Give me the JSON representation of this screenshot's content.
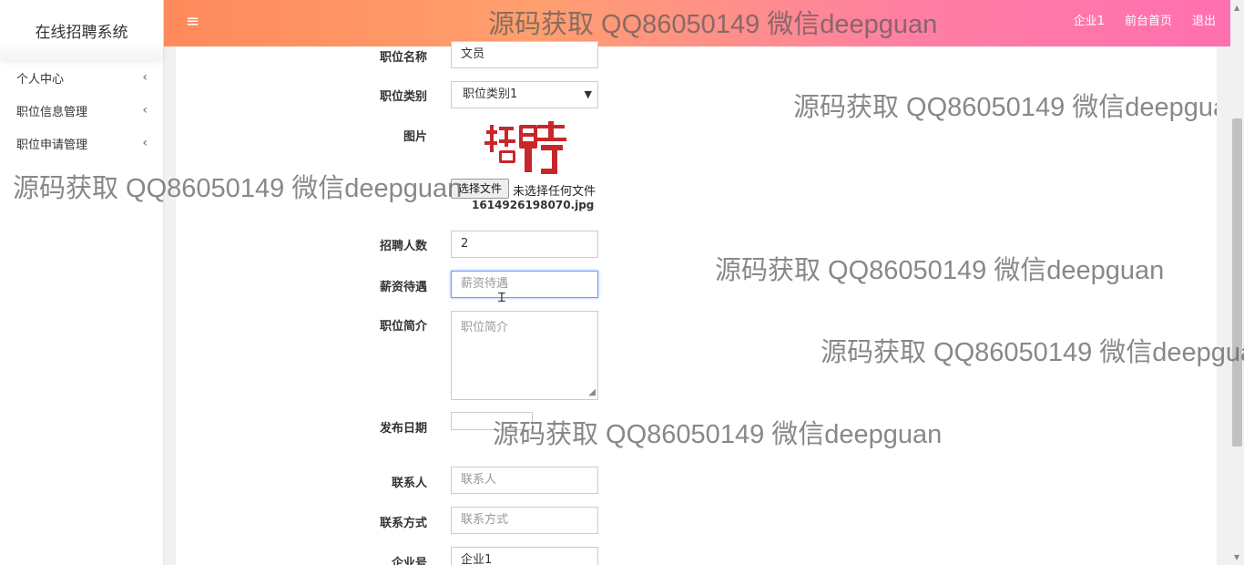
{
  "app": {
    "title": "在线招聘系统"
  },
  "sidebar": {
    "items": [
      {
        "label": "个人中心"
      },
      {
        "label": "职位信息管理"
      },
      {
        "label": "职位申请管理"
      }
    ],
    "chevron": "‹"
  },
  "header": {
    "menu_icon": "≡",
    "links": [
      {
        "label": "企业1"
      },
      {
        "label": "前台首页"
      },
      {
        "label": "退出"
      }
    ]
  },
  "form": {
    "job_name": {
      "label": "职位名称",
      "value": "文员"
    },
    "job_category": {
      "label": "职位类别",
      "value": "职位类别1"
    },
    "image": {
      "label": "图片",
      "file_button": "选择文件",
      "file_status": "未选择任何文件",
      "file_name": "1614926198070.jpg"
    },
    "headcount": {
      "label": "招聘人数",
      "value": "2"
    },
    "salary": {
      "label": "薪资待遇",
      "placeholder": "薪资待遇"
    },
    "intro": {
      "label": "职位简介",
      "placeholder": "职位简介"
    },
    "publish_date": {
      "label": "发布日期",
      "value": ""
    },
    "contact": {
      "label": "联系人",
      "placeholder": "联系人"
    },
    "contact_info": {
      "label": "联系方式",
      "placeholder": "联系方式"
    },
    "company_id": {
      "label": "企业号",
      "value": "企业1"
    }
  },
  "watermark": {
    "text": "源码获取 QQ86050149 微信deepguan"
  },
  "colors": {
    "header_start": "#ff8a5c",
    "header_end": "#ff6fb0",
    "logo_red": "#c8262b",
    "focus": "#6aa0ff"
  }
}
